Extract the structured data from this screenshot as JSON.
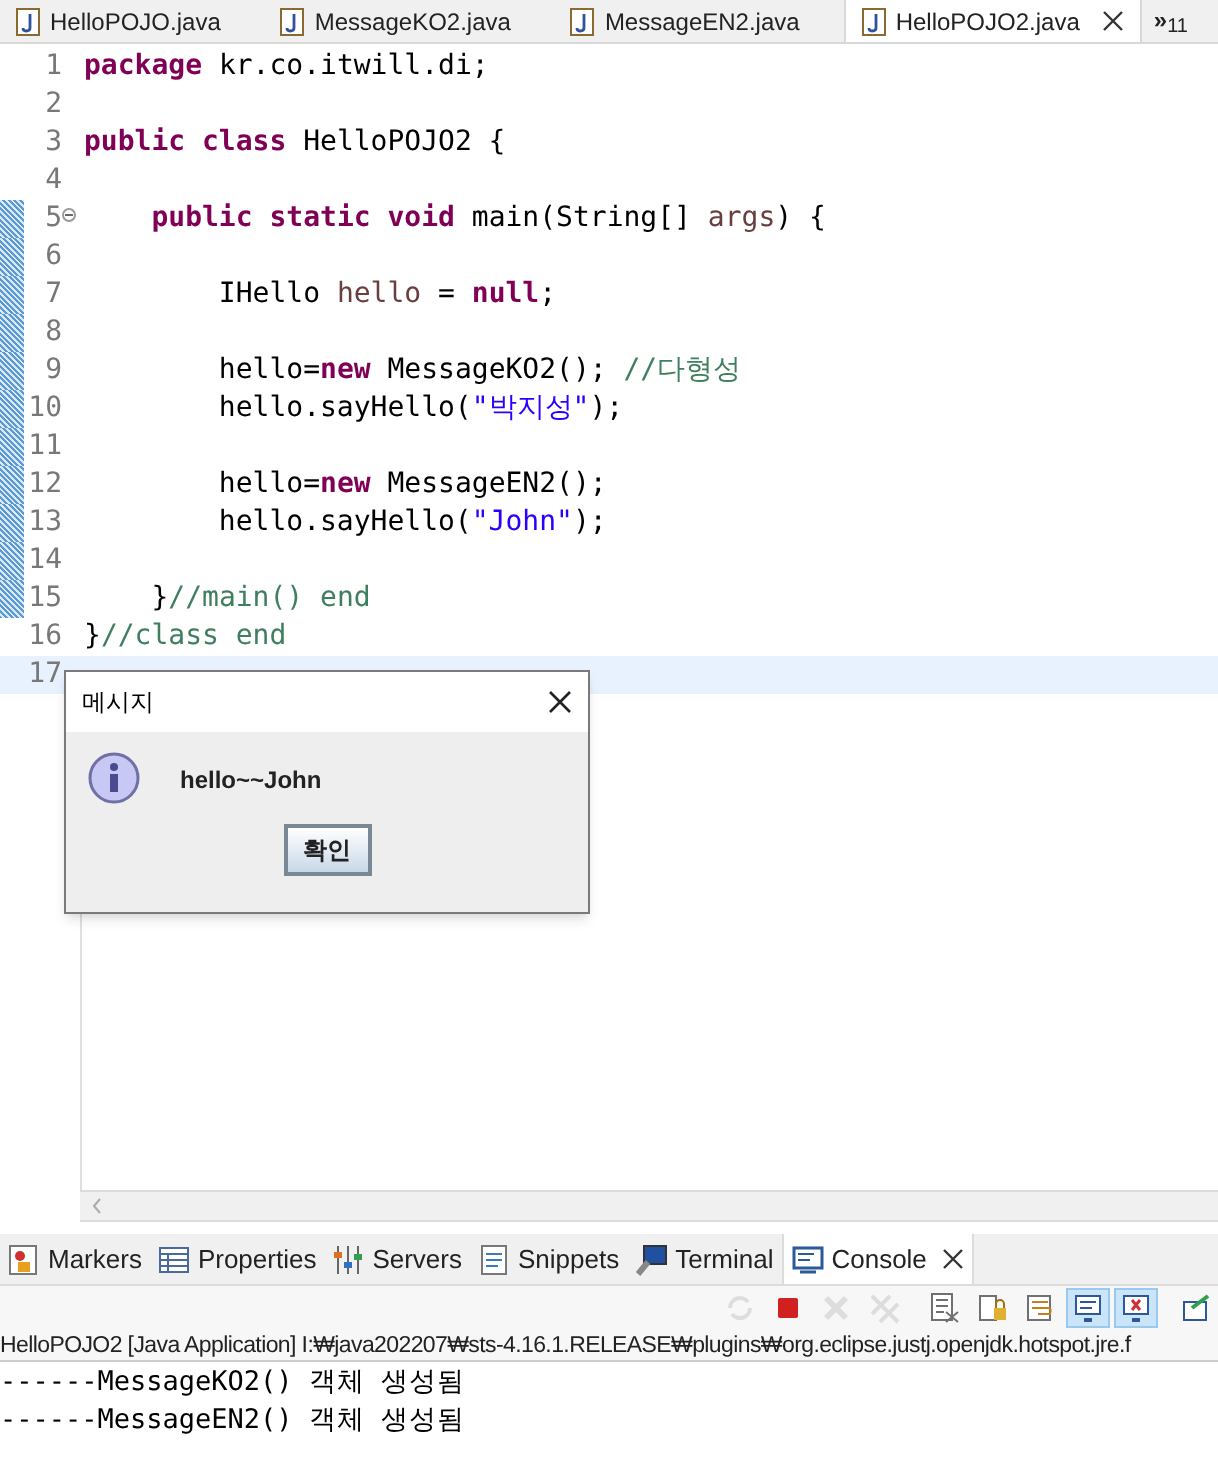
{
  "editor_tabs": [
    {
      "label": "HelloPOJO.java",
      "selected": false
    },
    {
      "label": "MessageKO2.java",
      "selected": false
    },
    {
      "label": "MessageEN2.java",
      "selected": false
    },
    {
      "label": "HelloPOJO2.java",
      "selected": true
    }
  ],
  "overflow": {
    "chevron": "»",
    "count": "11"
  },
  "code_lines": [
    {
      "number": "1",
      "changed": false,
      "folding": false,
      "current": false,
      "tokens": [
        {
          "kind": "keyword",
          "text": "package"
        },
        {
          "kind": "plain",
          "text": " kr.co.itwill.di;"
        }
      ]
    },
    {
      "number": "2",
      "changed": false,
      "folding": false,
      "current": false
    },
    {
      "number": "3",
      "changed": false,
      "folding": false,
      "current": false,
      "tokens": [
        {
          "kind": "keyword",
          "text": "public"
        },
        {
          "kind": "keyword",
          "text": " class"
        },
        {
          "kind": "plain",
          "text": " HelloPOJO2 {"
        }
      ]
    },
    {
      "number": "4",
      "changed": false,
      "folding": false,
      "current": false
    },
    {
      "number": "5",
      "changed": true,
      "folding": true,
      "current": false,
      "tokens": [
        {
          "kind": "keyword",
          "text": "    public"
        },
        {
          "kind": "keyword",
          "text": " static"
        },
        {
          "kind": "keyword",
          "text": " void"
        },
        {
          "kind": "plain",
          "text": " main(String[] "
        },
        {
          "kind": "variable",
          "text": "args"
        },
        {
          "kind": "plain",
          "text": ") {"
        }
      ]
    },
    {
      "number": "6",
      "changed": true,
      "folding": false,
      "current": false
    },
    {
      "number": "7",
      "changed": true,
      "folding": false,
      "current": false,
      "tokens": [
        {
          "kind": "plain",
          "text": "        IHello "
        },
        {
          "kind": "variable",
          "text": "hello"
        },
        {
          "kind": "plain",
          "text": " = "
        },
        {
          "kind": "keyword",
          "text": "null"
        },
        {
          "kind": "plain",
          "text": ";"
        }
      ]
    },
    {
      "number": "8",
      "changed": true,
      "folding": false,
      "current": false
    },
    {
      "number": "9",
      "changed": true,
      "folding": false,
      "current": false,
      "tokens": [
        {
          "kind": "plain",
          "text": "        hello="
        },
        {
          "kind": "keyword",
          "text": "new"
        },
        {
          "kind": "plain",
          "text": " MessageKO2(); "
        },
        {
          "kind": "comment",
          "text": "//다형성"
        }
      ]
    },
    {
      "number": "10",
      "changed": true,
      "folding": false,
      "current": false,
      "tokens": [
        {
          "kind": "plain",
          "text": "        hello.sayHello("
        },
        {
          "kind": "string",
          "text": "\"박지성\""
        },
        {
          "kind": "plain",
          "text": ");"
        }
      ]
    },
    {
      "number": "11",
      "changed": true,
      "folding": false,
      "current": false
    },
    {
      "number": "12",
      "changed": true,
      "folding": false,
      "current": false,
      "tokens": [
        {
          "kind": "plain",
          "text": "        hello="
        },
        {
          "kind": "keyword",
          "text": "new"
        },
        {
          "kind": "plain",
          "text": " MessageEN2();"
        }
      ]
    },
    {
      "number": "13",
      "changed": true,
      "folding": false,
      "current": false,
      "tokens": [
        {
          "kind": "plain",
          "text": "        hello.sayHello("
        },
        {
          "kind": "string",
          "text": "\"John\""
        },
        {
          "kind": "plain",
          "text": ");"
        }
      ]
    },
    {
      "number": "14",
      "changed": true,
      "folding": false,
      "current": false
    },
    {
      "number": "15",
      "changed": true,
      "folding": false,
      "current": false,
      "tokens": [
        {
          "kind": "plain",
          "text": "    }"
        },
        {
          "kind": "comment",
          "text": "//main() end"
        }
      ]
    },
    {
      "number": "16",
      "changed": false,
      "folding": false,
      "current": false,
      "tokens": [
        {
          "kind": "plain",
          "text": "}"
        },
        {
          "kind": "comment",
          "text": "//class end"
        }
      ]
    },
    {
      "number": "17",
      "changed": false,
      "folding": false,
      "current": true
    }
  ],
  "dialog": {
    "title": "메시지",
    "message": "hello~~John",
    "button": "확인"
  },
  "view_tabs": [
    {
      "label": "Markers",
      "kind": "markers",
      "selected": false
    },
    {
      "label": "Properties",
      "kind": "properties",
      "selected": false
    },
    {
      "label": "Servers",
      "kind": "servers",
      "selected": false
    },
    {
      "label": "Snippets",
      "kind": "snippets",
      "selected": false
    },
    {
      "label": "Terminal",
      "kind": "terminal",
      "selected": false
    },
    {
      "label": "Console",
      "kind": "console",
      "selected": true
    }
  ],
  "console_toolbar": [
    {
      "kind": "sync",
      "disabled": true,
      "selected": false
    },
    {
      "kind": "stop",
      "disabled": false,
      "selected": false
    },
    {
      "kind": "remove",
      "disabled": true,
      "selected": false
    },
    {
      "kind": "remove-all",
      "disabled": true,
      "selected": false
    },
    {
      "kind": "clear",
      "disabled": false,
      "selected": false
    },
    {
      "kind": "lock",
      "disabled": false,
      "selected": false
    },
    {
      "kind": "wrap",
      "disabled": false,
      "selected": false
    },
    {
      "kind": "show-out",
      "disabled": false,
      "selected": true
    },
    {
      "kind": "show-err",
      "disabled": false,
      "selected": true
    },
    {
      "kind": "pin",
      "disabled": false,
      "selected": false
    }
  ],
  "console_header": "HelloPOJO2 [Java Application] I:₩java202207₩sts-4.16.1.RELEASE₩plugins₩org.eclipse.justj.openjdk.hotspot.jre.f",
  "console_output": [
    "------MessageKO2() 객체 생성됨",
    "------MessageEN2() 객체 생성됨"
  ]
}
